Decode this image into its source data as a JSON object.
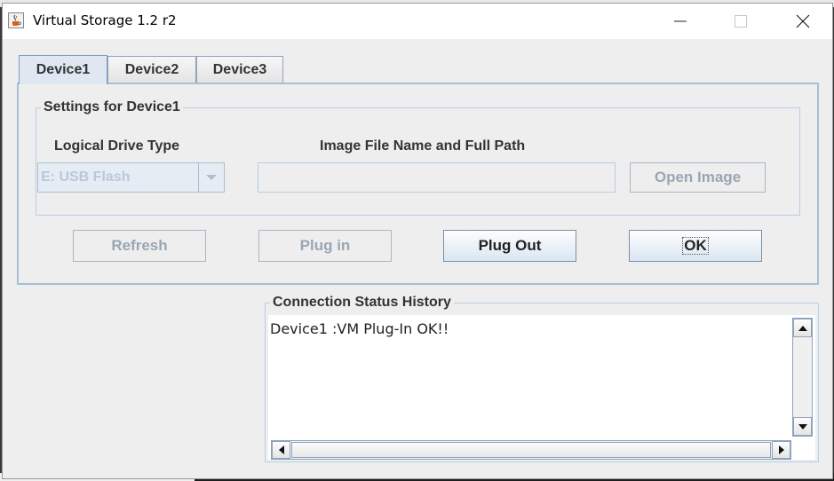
{
  "window": {
    "title": "Virtual Storage 1.2 r2",
    "icon": "java-cup-icon"
  },
  "tabs": [
    {
      "label": "Device1",
      "active": true
    },
    {
      "label": "Device2",
      "active": false
    },
    {
      "label": "Device3",
      "active": false
    }
  ],
  "settings": {
    "group_title": "Settings for Device1",
    "drive_type_label": "Logical Drive Type",
    "drive_type_value": "E: USB Flash",
    "image_path_label": "Image File Name and Full Path",
    "image_path_value": "",
    "open_image_label": "Open Image"
  },
  "actions": {
    "refresh_label": "Refresh",
    "plug_in_label": "Plug in",
    "plug_out_label": "Plug Out",
    "ok_label": "OK"
  },
  "status": {
    "group_title": "Connection Status History",
    "lines": [
      "Device1 :VM Plug-In OK!!"
    ]
  },
  "colors": {
    "accent_border": "#a9bfd6",
    "disabled_text": "#9aa6b4",
    "window_bg": "#eeeeee"
  }
}
